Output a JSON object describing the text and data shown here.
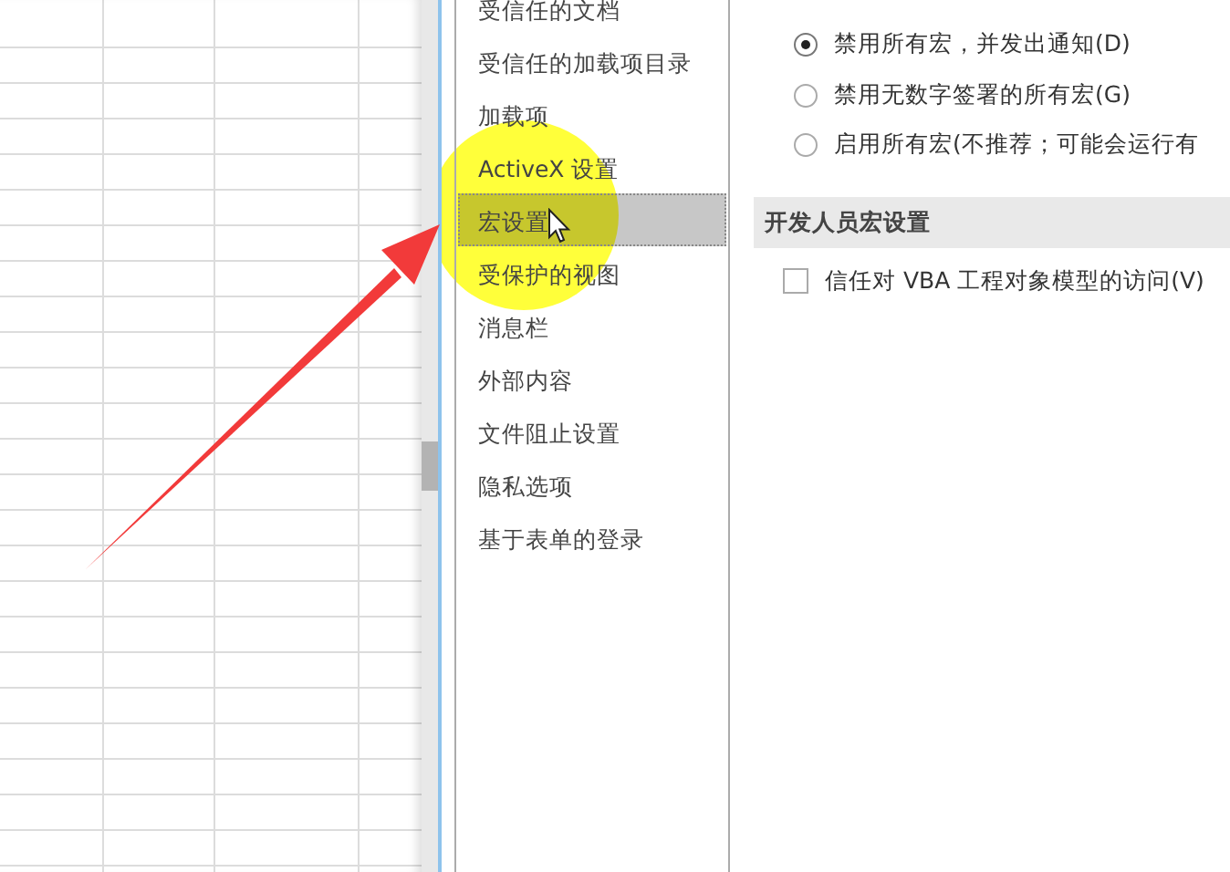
{
  "sidebar": {
    "items": [
      {
        "label": "受信任的文档",
        "selected": false
      },
      {
        "label": "受信任的加载项目录",
        "selected": false
      },
      {
        "label": "加载项",
        "selected": false
      },
      {
        "label": "ActiveX 设置",
        "selected": false
      },
      {
        "label": "宏设置",
        "selected": true
      },
      {
        "label": "受保护的视图",
        "selected": false
      },
      {
        "label": "消息栏",
        "selected": false
      },
      {
        "label": "外部内容",
        "selected": false
      },
      {
        "label": "文件阻止设置",
        "selected": false
      },
      {
        "label": "隐私选项",
        "selected": false
      },
      {
        "label": "基于表单的登录",
        "selected": false
      }
    ]
  },
  "macro_options": [
    {
      "label": "禁用所有宏，并发出通知(D)",
      "selected": true
    },
    {
      "label": "禁用无数字签署的所有宏(G)",
      "selected": false
    },
    {
      "label": "启用所有宏(不推荐；可能会运行有",
      "selected": false
    }
  ],
  "developer_section": {
    "title": "开发人员宏设置",
    "checkbox": {
      "label": "信任对 VBA 工程对象模型的访问(V)",
      "checked": false
    }
  }
}
